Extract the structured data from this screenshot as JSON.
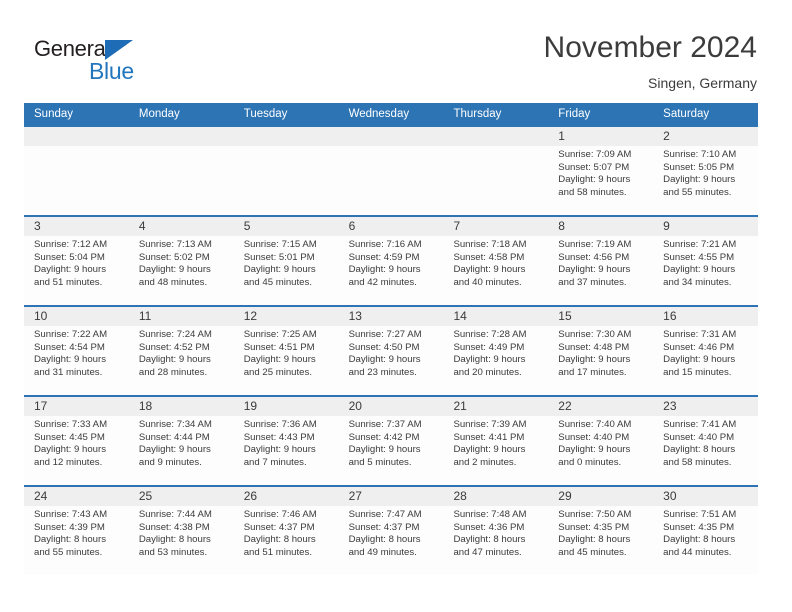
{
  "logo": {
    "word_top": "General",
    "word_bottom": "Blue",
    "triangle_color": "#1d6cb5",
    "bottom_color": "#2176bd"
  },
  "header": {
    "title": "November 2024",
    "subtitle": "Singen, Germany",
    "accent_color": "#2d74b5",
    "datestrip_color": "#efefef"
  },
  "weekdays": [
    "Sunday",
    "Monday",
    "Tuesday",
    "Wednesday",
    "Thursday",
    "Friday",
    "Saturday"
  ],
  "labels": {
    "sunrise_prefix": "Sunrise:",
    "sunset_prefix": "Sunset:",
    "daylight_prefix": "Daylight:"
  },
  "weeks": [
    [
      {
        "day": "",
        "line1": "",
        "line2": "",
        "line3": "",
        "line4": ""
      },
      {
        "day": "",
        "line1": "",
        "line2": "",
        "line3": "",
        "line4": ""
      },
      {
        "day": "",
        "line1": "",
        "line2": "",
        "line3": "",
        "line4": ""
      },
      {
        "day": "",
        "line1": "",
        "line2": "",
        "line3": "",
        "line4": ""
      },
      {
        "day": "",
        "line1": "",
        "line2": "",
        "line3": "",
        "line4": ""
      },
      {
        "day": "1",
        "line1": "Sunrise: 7:09 AM",
        "line2": "Sunset: 5:07 PM",
        "line3": "Daylight: 9 hours",
        "line4": "and 58 minutes."
      },
      {
        "day": "2",
        "line1": "Sunrise: 7:10 AM",
        "line2": "Sunset: 5:05 PM",
        "line3": "Daylight: 9 hours",
        "line4": "and 55 minutes."
      }
    ],
    [
      {
        "day": "3",
        "line1": "Sunrise: 7:12 AM",
        "line2": "Sunset: 5:04 PM",
        "line3": "Daylight: 9 hours",
        "line4": "and 51 minutes."
      },
      {
        "day": "4",
        "line1": "Sunrise: 7:13 AM",
        "line2": "Sunset: 5:02 PM",
        "line3": "Daylight: 9 hours",
        "line4": "and 48 minutes."
      },
      {
        "day": "5",
        "line1": "Sunrise: 7:15 AM",
        "line2": "Sunset: 5:01 PM",
        "line3": "Daylight: 9 hours",
        "line4": "and 45 minutes."
      },
      {
        "day": "6",
        "line1": "Sunrise: 7:16 AM",
        "line2": "Sunset: 4:59 PM",
        "line3": "Daylight: 9 hours",
        "line4": "and 42 minutes."
      },
      {
        "day": "7",
        "line1": "Sunrise: 7:18 AM",
        "line2": "Sunset: 4:58 PM",
        "line3": "Daylight: 9 hours",
        "line4": "and 40 minutes."
      },
      {
        "day": "8",
        "line1": "Sunrise: 7:19 AM",
        "line2": "Sunset: 4:56 PM",
        "line3": "Daylight: 9 hours",
        "line4": "and 37 minutes."
      },
      {
        "day": "9",
        "line1": "Sunrise: 7:21 AM",
        "line2": "Sunset: 4:55 PM",
        "line3": "Daylight: 9 hours",
        "line4": "and 34 minutes."
      }
    ],
    [
      {
        "day": "10",
        "line1": "Sunrise: 7:22 AM",
        "line2": "Sunset: 4:54 PM",
        "line3": "Daylight: 9 hours",
        "line4": "and 31 minutes."
      },
      {
        "day": "11",
        "line1": "Sunrise: 7:24 AM",
        "line2": "Sunset: 4:52 PM",
        "line3": "Daylight: 9 hours",
        "line4": "and 28 minutes."
      },
      {
        "day": "12",
        "line1": "Sunrise: 7:25 AM",
        "line2": "Sunset: 4:51 PM",
        "line3": "Daylight: 9 hours",
        "line4": "and 25 minutes."
      },
      {
        "day": "13",
        "line1": "Sunrise: 7:27 AM",
        "line2": "Sunset: 4:50 PM",
        "line3": "Daylight: 9 hours",
        "line4": "and 23 minutes."
      },
      {
        "day": "14",
        "line1": "Sunrise: 7:28 AM",
        "line2": "Sunset: 4:49 PM",
        "line3": "Daylight: 9 hours",
        "line4": "and 20 minutes."
      },
      {
        "day": "15",
        "line1": "Sunrise: 7:30 AM",
        "line2": "Sunset: 4:48 PM",
        "line3": "Daylight: 9 hours",
        "line4": "and 17 minutes."
      },
      {
        "day": "16",
        "line1": "Sunrise: 7:31 AM",
        "line2": "Sunset: 4:46 PM",
        "line3": "Daylight: 9 hours",
        "line4": "and 15 minutes."
      }
    ],
    [
      {
        "day": "17",
        "line1": "Sunrise: 7:33 AM",
        "line2": "Sunset: 4:45 PM",
        "line3": "Daylight: 9 hours",
        "line4": "and 12 minutes."
      },
      {
        "day": "18",
        "line1": "Sunrise: 7:34 AM",
        "line2": "Sunset: 4:44 PM",
        "line3": "Daylight: 9 hours",
        "line4": "and 9 minutes."
      },
      {
        "day": "19",
        "line1": "Sunrise: 7:36 AM",
        "line2": "Sunset: 4:43 PM",
        "line3": "Daylight: 9 hours",
        "line4": "and 7 minutes."
      },
      {
        "day": "20",
        "line1": "Sunrise: 7:37 AM",
        "line2": "Sunset: 4:42 PM",
        "line3": "Daylight: 9 hours",
        "line4": "and 5 minutes."
      },
      {
        "day": "21",
        "line1": "Sunrise: 7:39 AM",
        "line2": "Sunset: 4:41 PM",
        "line3": "Daylight: 9 hours",
        "line4": "and 2 minutes."
      },
      {
        "day": "22",
        "line1": "Sunrise: 7:40 AM",
        "line2": "Sunset: 4:40 PM",
        "line3": "Daylight: 9 hours",
        "line4": "and 0 minutes."
      },
      {
        "day": "23",
        "line1": "Sunrise: 7:41 AM",
        "line2": "Sunset: 4:40 PM",
        "line3": "Daylight: 8 hours",
        "line4": "and 58 minutes."
      }
    ],
    [
      {
        "day": "24",
        "line1": "Sunrise: 7:43 AM",
        "line2": "Sunset: 4:39 PM",
        "line3": "Daylight: 8 hours",
        "line4": "and 55 minutes."
      },
      {
        "day": "25",
        "line1": "Sunrise: 7:44 AM",
        "line2": "Sunset: 4:38 PM",
        "line3": "Daylight: 8 hours",
        "line4": "and 53 minutes."
      },
      {
        "day": "26",
        "line1": "Sunrise: 7:46 AM",
        "line2": "Sunset: 4:37 PM",
        "line3": "Daylight: 8 hours",
        "line4": "and 51 minutes."
      },
      {
        "day": "27",
        "line1": "Sunrise: 7:47 AM",
        "line2": "Sunset: 4:37 PM",
        "line3": "Daylight: 8 hours",
        "line4": "and 49 minutes."
      },
      {
        "day": "28",
        "line1": "Sunrise: 7:48 AM",
        "line2": "Sunset: 4:36 PM",
        "line3": "Daylight: 8 hours",
        "line4": "and 47 minutes."
      },
      {
        "day": "29",
        "line1": "Sunrise: 7:50 AM",
        "line2": "Sunset: 4:35 PM",
        "line3": "Daylight: 8 hours",
        "line4": "and 45 minutes."
      },
      {
        "day": "30",
        "line1": "Sunrise: 7:51 AM",
        "line2": "Sunset: 4:35 PM",
        "line3": "Daylight: 8 hours",
        "line4": "and 44 minutes."
      }
    ]
  ]
}
